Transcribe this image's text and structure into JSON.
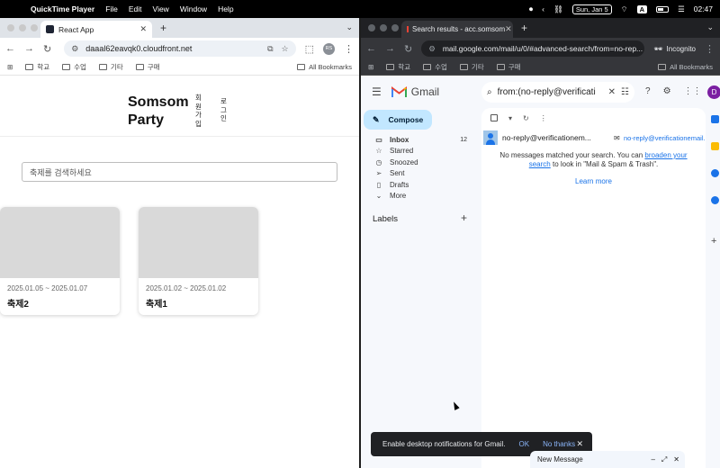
{
  "menubar": {
    "app": "QuickTime Player",
    "items": [
      "File",
      "Edit",
      "View",
      "Window",
      "Help"
    ],
    "date": "Sun, Jan 5",
    "input_badge": "A",
    "time": "02:47"
  },
  "left_browser": {
    "tab_title": "React App",
    "url": "daaal62eavqk0.cloudfront.net",
    "profile_initials": "RS",
    "bookmarks": [
      "학교",
      "수업",
      "기타",
      "구매"
    ],
    "all_bookmarks": "All Bookmarks",
    "site": {
      "logo_line1": "Somsom",
      "logo_line2": "Party",
      "signup": "회원가입",
      "login": "로그인",
      "search_placeholder": "축제를 검색하세요",
      "cards": [
        {
          "dates": "2025.01.05 ~ 2025.01.07",
          "title": "축제2"
        },
        {
          "dates": "2025.01.02 ~ 2025.01.02",
          "title": "축제1"
        }
      ]
    }
  },
  "right_browser": {
    "tab_title": "Search results - acc.somsom",
    "url": "mail.google.com/mail/u/0/#advanced-search/from=no-rep...",
    "incognito": "Incognito",
    "bookmarks": [
      "학교",
      "수업",
      "기타",
      "구매"
    ],
    "all_bookmarks": "All Bookmarks",
    "gmail": {
      "brand": "Gmail",
      "search_value": "from:(no-reply@verificati",
      "avatar": "D",
      "compose": "Compose",
      "nav": [
        {
          "label": "Inbox",
          "count": "12"
        },
        {
          "label": "Starred",
          "count": ""
        },
        {
          "label": "Snoozed",
          "count": ""
        },
        {
          "label": "Sent",
          "count": ""
        },
        {
          "label": "Drafts",
          "count": ""
        },
        {
          "label": "More",
          "count": ""
        }
      ],
      "labels_heading": "Labels",
      "contact_name": "no-reply@verificationem...",
      "contact_email": "no-reply@verificationemail...",
      "no_messages_prefix": "No messages matched your search. You can ",
      "broaden_link": "broaden your search",
      "no_messages_suffix": " to look in \"Mail & Spam & Trash\".",
      "learn_more": "Learn more",
      "toast_text": "Enable desktop notifications for Gmail.",
      "toast_ok": "OK",
      "toast_no": "No thanks",
      "new_message": "New Message"
    }
  }
}
